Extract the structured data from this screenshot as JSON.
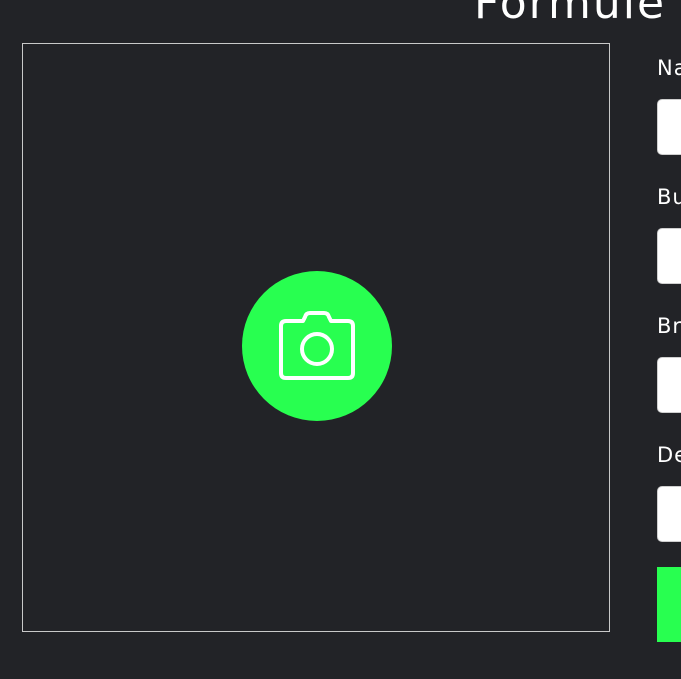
{
  "header": {
    "title": "Formulé"
  },
  "photo_upload": {
    "icon": "camera-icon",
    "accent_color": "#28ff50",
    "border_color": "#c9c9c9"
  },
  "form": {
    "fields": [
      {
        "label": "Na",
        "value": ""
      },
      {
        "label": "Bu",
        "value": ""
      },
      {
        "label": "Br",
        "value": ""
      },
      {
        "label": "De",
        "value": ""
      }
    ],
    "submit_label": ""
  },
  "colors": {
    "background": "#222327",
    "accent": "#28ff50",
    "text": "#ffffff"
  }
}
